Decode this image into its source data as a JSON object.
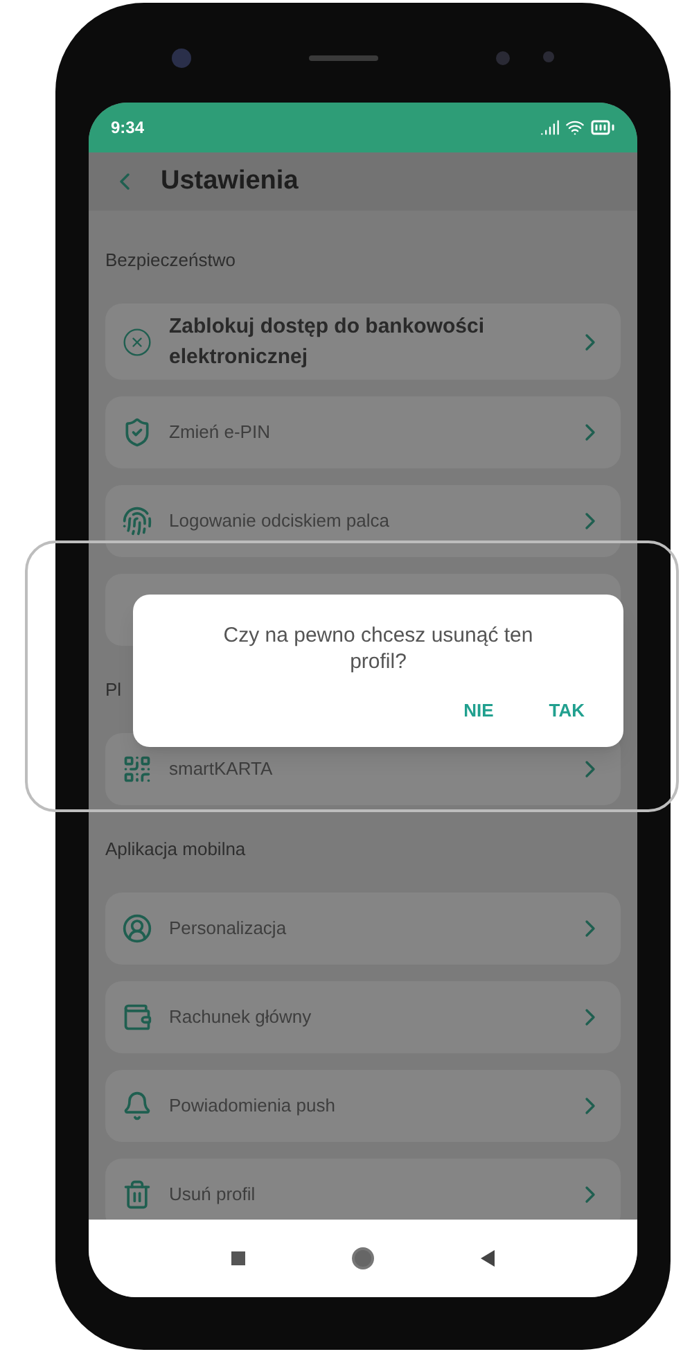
{
  "status_bar": {
    "time": "9:34"
  },
  "header": {
    "title": "Ustawienia"
  },
  "sections": [
    {
      "title": "Bezpieczeństwo",
      "items": [
        {
          "kind": "block",
          "label": "Zablokuj dostęp do bankowości elektronicznej",
          "emphasized": true
        },
        {
          "kind": "shield",
          "label": "Zmień e-PIN",
          "emphasized": false
        },
        {
          "kind": "fingerprint",
          "label": "Logowanie odciskiem palca",
          "emphasized": false
        },
        {
          "kind": "covered"
        }
      ]
    },
    {
      "title": "Pl",
      "items": [
        {
          "kind": "card",
          "label": "smartKARTA",
          "emphasized": false
        }
      ]
    },
    {
      "title": "Aplikacja mobilna",
      "items": [
        {
          "kind": "user",
          "label": "Personalizacja",
          "emphasized": false
        },
        {
          "kind": "wallet",
          "label": "Rachunek główny",
          "emphasized": false
        },
        {
          "kind": "bell",
          "label": "Powiadomienia push",
          "emphasized": false
        },
        {
          "kind": "trash",
          "label": "Usuń profil",
          "emphasized": false
        }
      ]
    }
  ],
  "dialog": {
    "message": "Czy na pewno chcesz usunąć ten profil?",
    "buttons": [
      "NIE",
      "TAK"
    ]
  }
}
